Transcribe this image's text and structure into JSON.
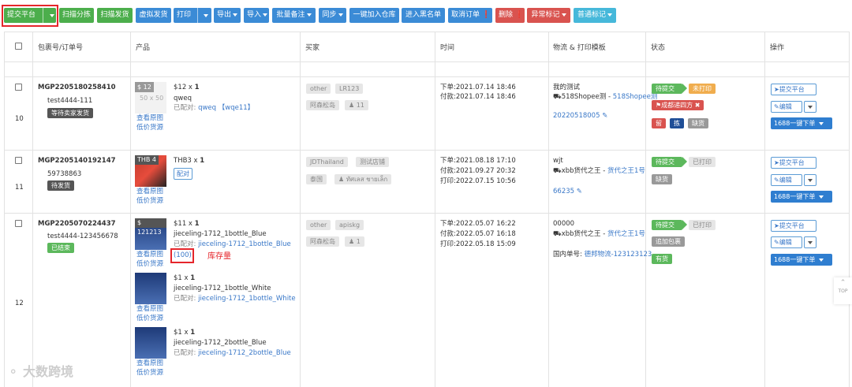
{
  "toolbar": {
    "submit_platform": "提交平台",
    "scan_split": "扫描分拣",
    "scan_ship": "扫描发货",
    "virtual_ship": "虚拟发货",
    "print": "打印",
    "export": "导出",
    "import": "导入",
    "batch_note": "批量备注",
    "sync": "同步",
    "add_to_warehouse": "一键加入仓库",
    "blacklist": "进入黑名单",
    "cancel_order": "取消订单",
    "delete": "删除",
    "abnormal_mark": "异常标记",
    "normal_mark": "普通标记"
  },
  "columns": [
    "包裹号/订单号",
    "产品",
    "买家",
    "时间",
    "物流 & 打印模板",
    "状态",
    "操作"
  ],
  "rows": [
    {
      "row_num": "10",
      "package_no": "MGP2205180258410",
      "order_no": "test4444-111",
      "order_status": "等待卖家发货",
      "products": [
        {
          "badge": "$ 12",
          "size": "50 x 50",
          "price_qty": "$12 x ",
          "qty": "1",
          "name": "qweq",
          "match_label": "已配对:",
          "match": "qweq 【wqe11】",
          "view_image": "查看原图",
          "low_price": "低价货源"
        }
      ],
      "buyer": {
        "shop": "other",
        "id": "LR123",
        "region": "阿森松岛",
        "count": "11"
      },
      "time": {
        "order": "下单:2021.07.14 18:46",
        "paid": "付款:2021.07.14 18:46"
      },
      "logistics": {
        "line1": "我的测试",
        "carrier": "518Shopee测 - ",
        "carrier_link": "518Shopee测",
        "tracking": "20220518005"
      },
      "status": {
        "s1": "待提交",
        "s2": "未打印",
        "s3": "成都递四方",
        "t1": "留",
        "t2": "拣",
        "t3": "缺货"
      },
      "ops": {
        "submit": "提交平台",
        "edit": "编辑",
        "order1688": "1688一键下单"
      }
    },
    {
      "row_num": "11",
      "package_no": "MGP2205140192147",
      "order_no": "59738863",
      "order_status": "待发货",
      "products": [
        {
          "badge": "THB 4",
          "price_qty": "THB3 x ",
          "qty": "1",
          "match_btn": "配对",
          "view_image": "查看原图",
          "low_price": "低价货源"
        }
      ],
      "buyer": {
        "shop": "JDThailand",
        "id": "测试店铺",
        "region": "泰国",
        "name": "ทัศเลส ชายเล็ก"
      },
      "time": {
        "order": "下单:2021.08.18 17:10",
        "paid": "付款:2021.09.27 20:32",
        "printed": "打印:2022.07.15 10:56"
      },
      "logistics": {
        "line1": "wjt",
        "carrier": "xbb货代之王 - ",
        "carrier_link": "货代之王1号",
        "tracking": "66235"
      },
      "status": {
        "s1": "待提交",
        "s2": "已打印",
        "t3": "缺货"
      },
      "ops": {
        "submit": "提交平台",
        "edit": "编辑",
        "order1688": "1688一键下单"
      }
    },
    {
      "row_num": "12",
      "package_no": "MGP2205070224437",
      "order_no": "test4444-123456678",
      "order_status": "已结束",
      "products": [
        {
          "badge": "$ 121213",
          "price_qty": "$11 x ",
          "qty": "1",
          "name": "jieceling-1712_1bottle_Blue",
          "match_label": "已配对:",
          "match": "jieceling-1712_1bottle_Blue",
          "stock": "(100)",
          "stock_label": "库存量",
          "view_image": "查看原图",
          "low_price": "低价货源"
        },
        {
          "price_qty": "$1 x ",
          "qty": "1",
          "name": "jieceling-1712_1bottle_White",
          "match_label": "已配对:",
          "match": "jieceling-1712_1bottle_White",
          "view_image": "查看原图",
          "low_price": "低价货源"
        },
        {
          "price_qty": "$1 x ",
          "qty": "1",
          "name": "jieceling-1712_2bottle_Blue",
          "match_label": "已配对:",
          "match": "jieceling-1712_2bottle_Blue",
          "view_image": "查看原图",
          "low_price": "低价货源"
        }
      ],
      "buyer": {
        "shop": "other",
        "id": "apiskg",
        "region": "阿森松岛",
        "count": "1"
      },
      "time": {
        "order": "下单:2022.05.07 16:22",
        "paid": "付款:2022.05.07 16:18",
        "printed": "打印:2022.05.18 15:09"
      },
      "logistics": {
        "line1": "00000",
        "carrier": "xbb货代之王 - ",
        "carrier_link": "货代之王1号",
        "domestic_label": "国内单号: ",
        "domestic": "德邦物流-123123123"
      },
      "status": {
        "s1": "待提交",
        "s2": "已打印",
        "s4": "追加包裹",
        "s5": "有货"
      },
      "ops": {
        "submit": "提交平台",
        "edit": "编辑",
        "order1688": "1688一键下单"
      }
    }
  ],
  "top_button": "TOP",
  "watermark": "大数跨境"
}
